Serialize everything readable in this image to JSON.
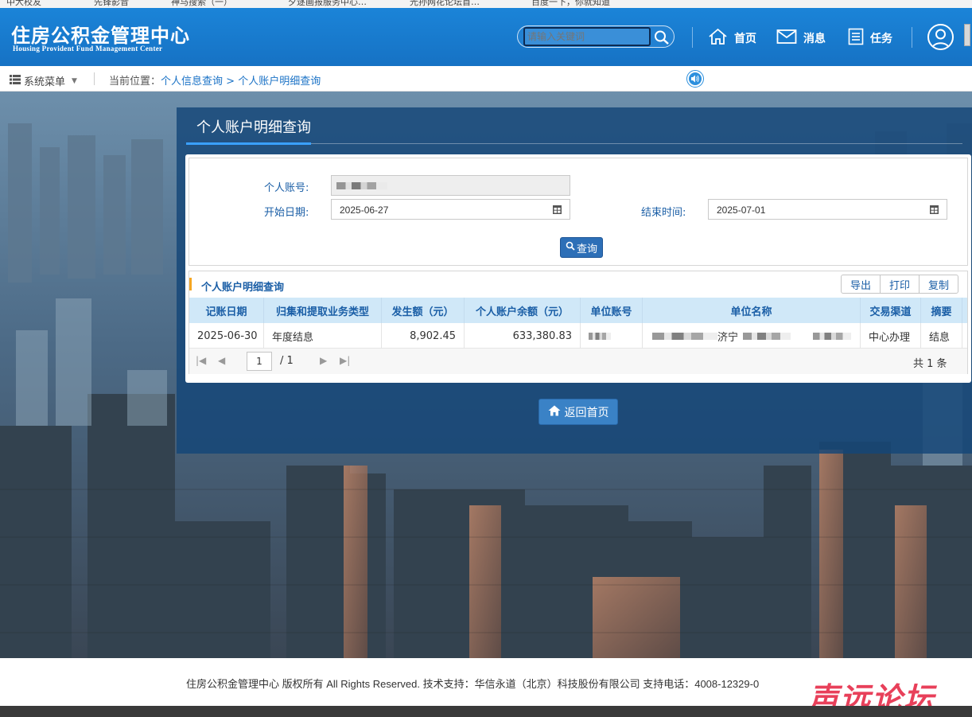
{
  "bookmarks": [
    "中大校友",
    "先锋影音",
    "神马搜索（一）",
    "夕逐画报服务中心…",
    "光孙网花论坛首…",
    "百度一下，你就知道"
  ],
  "header": {
    "logo_cn": "住房公积金管理中心",
    "logo_en": "Housing Provident Fund Management Center",
    "search_placeholder": "请输入关键词",
    "nav": [
      {
        "label": "首页",
        "icon": "home-icon"
      },
      {
        "label": "消息",
        "icon": "mail-icon"
      },
      {
        "label": "任务",
        "icon": "task-list-icon"
      }
    ],
    "avatar_icon": "user-avatar-icon"
  },
  "breadcrumb": {
    "menu_label": "系统菜单",
    "prefix": "当前位置：",
    "level1": "个人信息查询",
    "separator": " > ",
    "level2": "个人账户明细查询"
  },
  "panel": {
    "title": "个人账户明细查询"
  },
  "form": {
    "account_label": "个人账号:",
    "account_value": "",
    "start_label": "开始日期:",
    "start_value": "2025-06-27",
    "end_label": "结束时间:",
    "end_value": "2025-07-01",
    "query_label": "查询"
  },
  "grid": {
    "title": "个人账户明细查询",
    "actions": [
      "导出",
      "打印",
      "复制"
    ],
    "columns": [
      "记账日期",
      "归集和提取业务类型",
      "发生额（元）",
      "个人账户余额（元）",
      "单位账号",
      "单位名称",
      "交易渠道",
      "摘要"
    ],
    "rows": [
      {
        "date": "2025-06-30",
        "type": "年度结息",
        "amount": "8,902.45",
        "balance": "633,380.83",
        "unit_account": "",
        "unit_name_visible": "济宁",
        "channel": "中心办理",
        "summary": "结息"
      }
    ],
    "pager": {
      "current": "1",
      "total_pages": "/ 1",
      "total_label": "共 1 条"
    }
  },
  "home_button": "返回首页",
  "footer": {
    "text": "住房公积金管理中心 版权所有 All Rights Reserved. 技术支持：华信永道（北京）科技股份有限公司 支持电话：4008-12329-0",
    "watermark": "声远论坛"
  },
  "colors": {
    "header_blue": "#1b84d8",
    "link_blue": "#1a72c6",
    "accent_orange": "#f5a623",
    "watermark_red": "#e8405a"
  }
}
